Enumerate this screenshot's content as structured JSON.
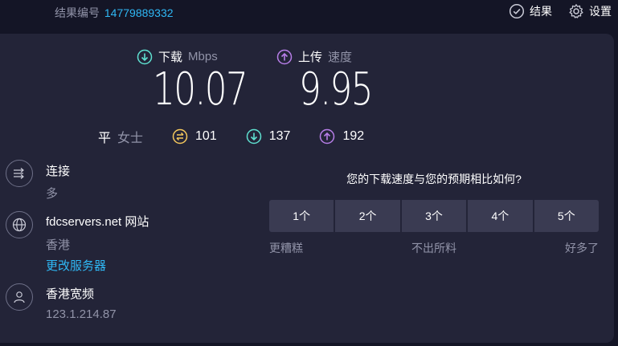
{
  "header": {
    "result_label": "结果编号",
    "result_id": "14779889332",
    "results_label": "结果",
    "settings_label": "设置"
  },
  "download": {
    "label": "下载",
    "unit": "Mbps",
    "value": "10.07"
  },
  "upload": {
    "label": "上传",
    "unit": "速度",
    "value": "9.95"
  },
  "ping": {
    "label": "平",
    "sub": "女士",
    "idle": "101",
    "download": "137",
    "upload": "192"
  },
  "connections": {
    "title": "连接",
    "value": "多"
  },
  "server": {
    "name": "fdcservers.net 网站",
    "location": "香港",
    "change_label": "更改服务器"
  },
  "provider": {
    "name": "香港宽频",
    "ip": "123.1.214.87"
  },
  "survey": {
    "question": "您的下载速度与您的预期相比如何?",
    "options": [
      "1个",
      "2个",
      "3个",
      "4个",
      "5个"
    ],
    "scale_low": "更糟糕",
    "scale_mid": "不出所料",
    "scale_high": "好多了"
  },
  "colors": {
    "download": "#5fe0d0",
    "upload": "#b77ee8",
    "ping": "#f5c85c",
    "link": "#2fb8f5",
    "panel": "#232438",
    "background": "#141526"
  },
  "icons": {
    "download": "arrow-down-circle",
    "upload": "arrow-up-circle",
    "ping": "ping-circle",
    "results": "check-circle",
    "settings": "gear",
    "connections": "arrows-right",
    "server": "globe",
    "provider": "person"
  }
}
